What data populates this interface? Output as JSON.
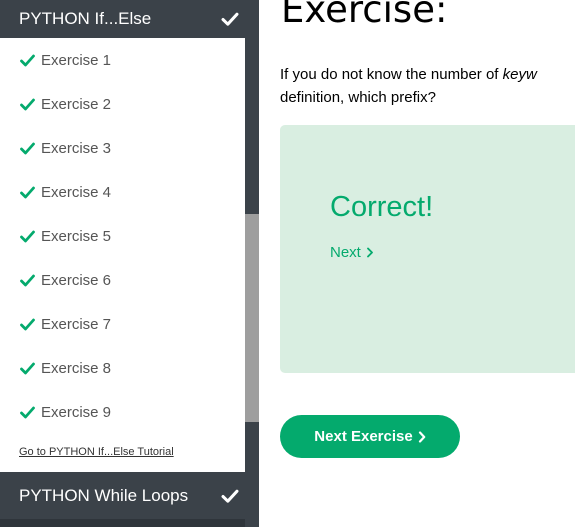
{
  "sidebar": {
    "top_section": {
      "label": "PYTHON If...Else",
      "icon": "check-icon"
    },
    "exercises": [
      {
        "label": "Exercise 1",
        "icon": "check-icon"
      },
      {
        "label": "Exercise 2",
        "icon": "check-icon"
      },
      {
        "label": "Exercise 3",
        "icon": "check-icon"
      },
      {
        "label": "Exercise 4",
        "icon": "check-icon"
      },
      {
        "label": "Exercise 5",
        "icon": "check-icon"
      },
      {
        "label": "Exercise 6",
        "icon": "check-icon"
      },
      {
        "label": "Exercise 7",
        "icon": "check-icon"
      },
      {
        "label": "Exercise 8",
        "icon": "check-icon"
      },
      {
        "label": "Exercise 9",
        "icon": "check-icon"
      }
    ],
    "tutorial_link": "Go to PYTHON If...Else Tutorial",
    "bottom_section": {
      "label": "PYTHON While Loops",
      "icon": "check-icon"
    }
  },
  "main": {
    "title": "Exercise:",
    "question_part1": "If you do not know the number of ",
    "question_emphasis": "keyw",
    "question_line2": "definition, which prefix?",
    "result": {
      "message": "Correct!",
      "next_label": "Next"
    },
    "next_exercise_label": "Next Exercise"
  },
  "colors": {
    "sidebar_header_bg": "#3b4249",
    "accent_green": "#04aa6d",
    "result_bg": "#d9eee1",
    "scrollbar_thumb": "#9e9e9e"
  }
}
